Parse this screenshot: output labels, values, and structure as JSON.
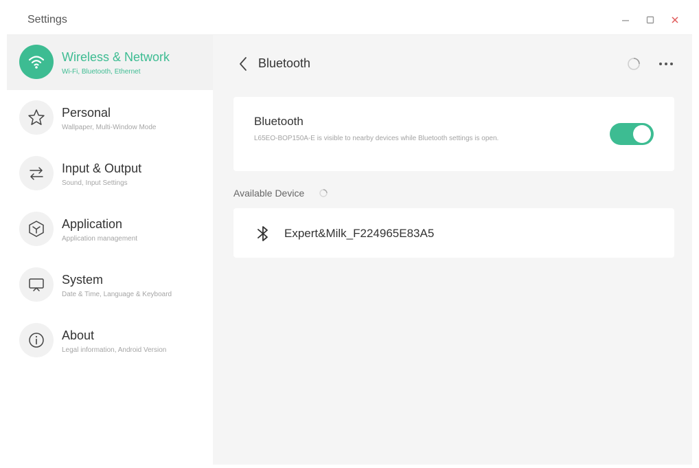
{
  "window": {
    "title": "Settings",
    "controls": {
      "minimize_icon": "minimize-icon",
      "maximize_icon": "maximize-icon",
      "close_icon": "close-icon"
    }
  },
  "sidebar": {
    "items": [
      {
        "label": "Wireless & Network",
        "sub": "Wi-Fi, Bluetooth, Ethernet",
        "icon": "wifi-icon",
        "active": true
      },
      {
        "label": "Personal",
        "sub": "Wallpaper, Multi-Window Mode",
        "icon": "star-icon",
        "active": false
      },
      {
        "label": "Input & Output",
        "sub": "Sound, Input Settings",
        "icon": "swap-arrows-icon",
        "active": false
      },
      {
        "label": "Application",
        "sub": "Application management",
        "icon": "application-cube-icon",
        "active": false
      },
      {
        "label": "System",
        "sub": "Date & Time, Language & Keyboard",
        "icon": "monitor-icon",
        "active": false
      },
      {
        "label": "About",
        "sub": "Legal information, Android Version",
        "icon": "info-icon",
        "active": false
      }
    ]
  },
  "main": {
    "title": "Bluetooth",
    "bluetooth_card": {
      "title": "Bluetooth",
      "description": "L65EO-BOP150A-E is visible to nearby devices while Bluetooth settings is open.",
      "enabled": true
    },
    "available_label": "Available Device",
    "devices": [
      {
        "name": "Expert&Milk_F224965E83A5",
        "icon": "bluetooth-icon"
      }
    ]
  },
  "colors": {
    "accent": "#3dbc92",
    "close": "#e05a5a",
    "background": "#f5f5f5"
  }
}
